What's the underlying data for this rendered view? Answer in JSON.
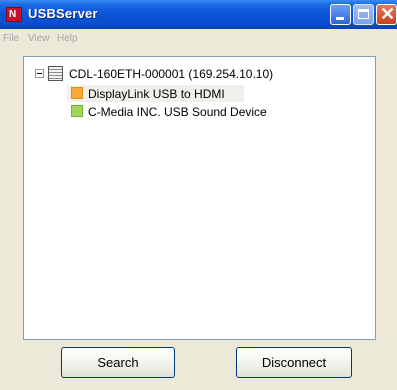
{
  "window": {
    "title": "USBServer",
    "icon": "usbserver-app-icon"
  },
  "menu": {
    "items": [
      "File",
      "View",
      "Help"
    ]
  },
  "tree": {
    "server": {
      "label": "CDL-160ETH-000001 (169.254.10.10)",
      "expanded": true,
      "devices": [
        {
          "label": "DisplayLink USB to HDMI",
          "status_color": "#F6A93A",
          "selected": true
        },
        {
          "label": "C-Media INC. USB Sound Device",
          "status_color": "#9FD65A",
          "selected": false
        }
      ]
    }
  },
  "buttons": {
    "search": "Search",
    "disconnect": "Disconnect"
  },
  "colors": {
    "titlebar": "#0B55D8",
    "window_bg": "#ECE9D8",
    "close_button": "#C9411F"
  }
}
